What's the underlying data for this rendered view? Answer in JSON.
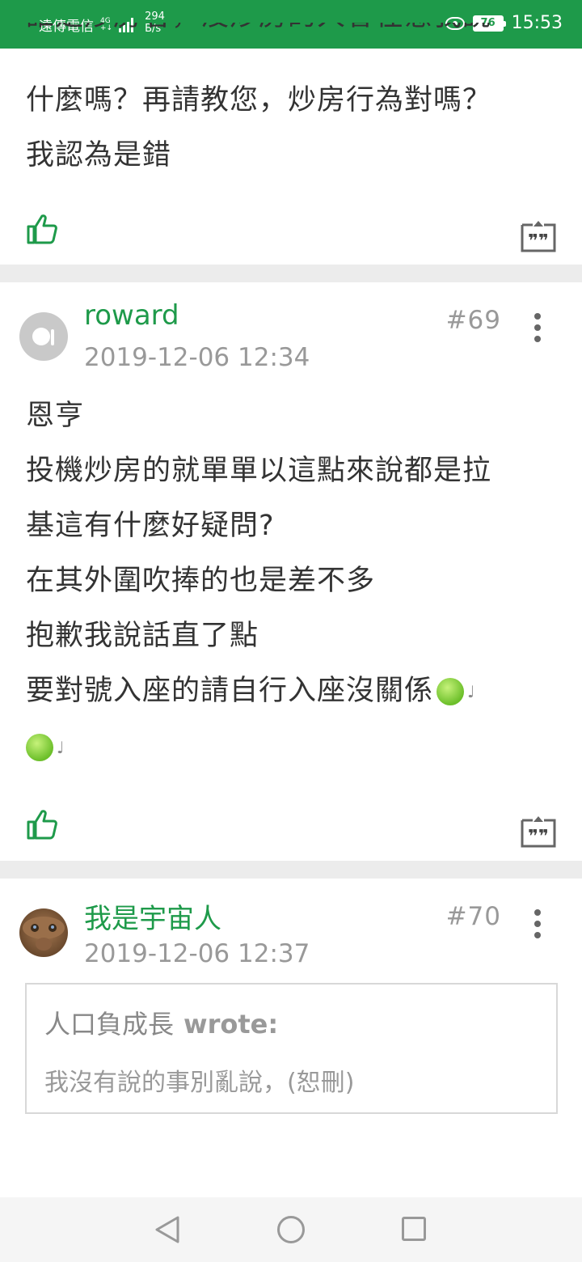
{
  "status_bar": {
    "carrier": "遠傳電信",
    "network_top": "4G",
    "network_bottom": "+↓",
    "speed_value": "294",
    "speed_unit": "B/s",
    "battery": "76",
    "time": "15:53"
  },
  "previous_post": {
    "partial_line": "誰是炒房者，沒炒房的人會在意我說",
    "lines": [
      "什麼嗎？再請教您，炒房行為對嗎？",
      "我認為是錯"
    ]
  },
  "posts": [
    {
      "username": "roward",
      "number": "#69",
      "date": "2019-12-06 12:34",
      "lines": [
        "恩亨",
        "投機炒房的就單單以這點來說都是拉",
        "基這有什麼好疑問?",
        "在其外圍吹捧的也是差不多",
        "抱歉我說話直了點",
        "要對號入座的請自行入座沒關係"
      ]
    },
    {
      "username": "我是宇宙人",
      "number": "#70",
      "date": "2019-12-06 12:37",
      "quote": {
        "author": "人口負成長",
        "wrote": "wrote:",
        "text": "我沒有說的事別亂說，(恕刪)"
      }
    }
  ],
  "colors": {
    "brand_green": "#1e9a4a",
    "divider": "#ececec"
  },
  "icons": {
    "like": "thumbs-up-icon",
    "quote": "quote-icon",
    "menu": "more-vertical-icon",
    "emoji": "green-devil-emoji-icon"
  }
}
